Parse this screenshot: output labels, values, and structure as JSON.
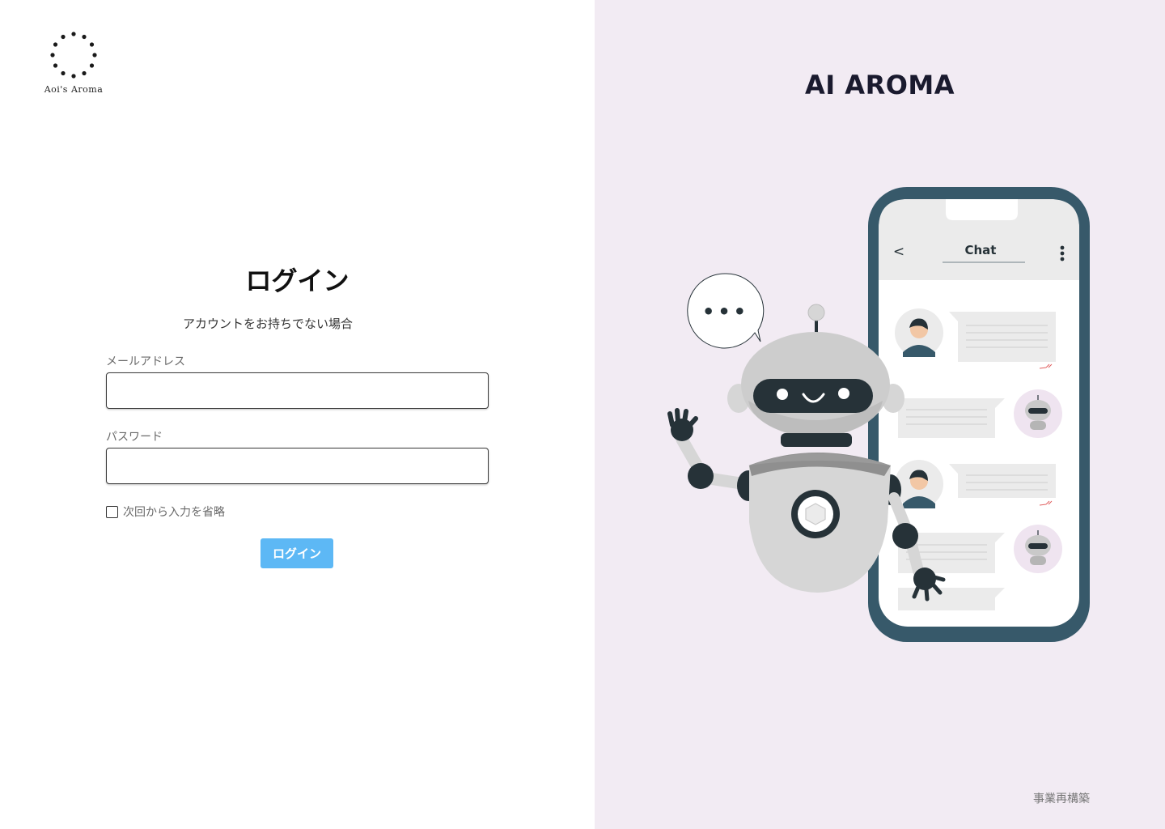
{
  "brand": {
    "logo_text": "Aoi's Aroma"
  },
  "login": {
    "title": "ログイン",
    "signup_link": "アカウントをお持ちでない場合",
    "email_label": "メールアドレス",
    "email_value": "",
    "password_label": "パスワード",
    "password_value": "",
    "remember_label": "次回から入力を省略",
    "remember_checked": false,
    "submit_label": "ログイン"
  },
  "hero": {
    "title": "AI AROMA",
    "chat_title": "Chat",
    "speech_bubble": "•••"
  },
  "footer": {
    "text": "事業再構築"
  },
  "colors": {
    "button": "#5db8f5",
    "right_background": "#f2ebf3",
    "phone_frame": "#37596a"
  },
  "icons": [
    "logo-dots-icon",
    "back-arrow-icon",
    "more-options-icon"
  ]
}
